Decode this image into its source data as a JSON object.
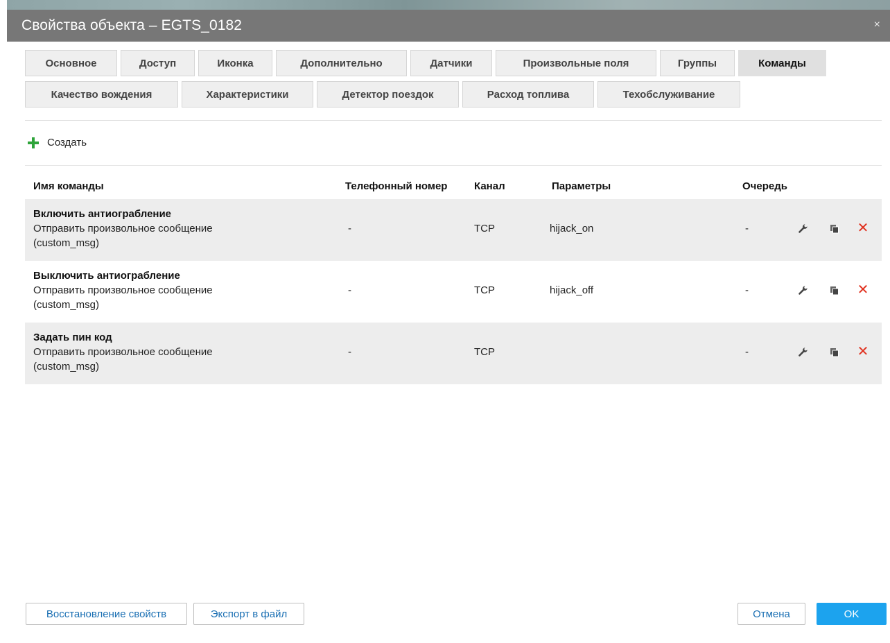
{
  "window": {
    "title": "Свойства объекта – EGTS_0182",
    "close_glyph": "×"
  },
  "tabs": {
    "row1": [
      "Основное",
      "Доступ",
      "Иконка",
      "Дополнительно",
      "Датчики",
      "Произвольные поля",
      "Группы",
      "Команды"
    ],
    "row2": [
      "Качество вождения",
      "Характеристики",
      "Детектор поездок",
      "Расход топлива",
      "Техобслуживание"
    ],
    "active": "Команды"
  },
  "toolbar": {
    "create_label": "Создать",
    "create_icon": "plus-icon",
    "create_color": "#2ea43a"
  },
  "table": {
    "headers": {
      "name": "Имя команды",
      "phone": "Телефонный номер",
      "channel": "Канал",
      "params": "Параметры",
      "queue": "Очередь"
    },
    "rows": [
      {
        "title": "Включить антиограбление",
        "type": "Отправить произвольное сообщение",
        "type_code": "(custom_msg)",
        "phone": "-",
        "channel": "TCP",
        "params": "hijack_on",
        "queue": "-"
      },
      {
        "title": "Выключить антиограбление",
        "type": "Отправить произвольное сообщение",
        "type_code": "(custom_msg)",
        "phone": "-",
        "channel": "TCP",
        "params": "hijack_off",
        "queue": "-"
      },
      {
        "title": "Задать пин код",
        "type": "Отправить произвольное сообщение",
        "type_code": "(custom_msg)",
        "phone": "-",
        "channel": "TCP",
        "params": "",
        "queue": "-"
      }
    ],
    "row_actions": [
      "wrench-icon",
      "copy-icon",
      "delete-icon"
    ],
    "delete_glyph": "✕"
  },
  "footer": {
    "restore_label": "Восстановление свойств",
    "export_label": "Экспорт в файл",
    "cancel_label": "Отмена",
    "ok_label": "OK"
  },
  "colors": {
    "titlebar": "#777777",
    "ok_button": "#1ca3ee",
    "link": "#1a6fb3",
    "delete": "#e0301e"
  }
}
